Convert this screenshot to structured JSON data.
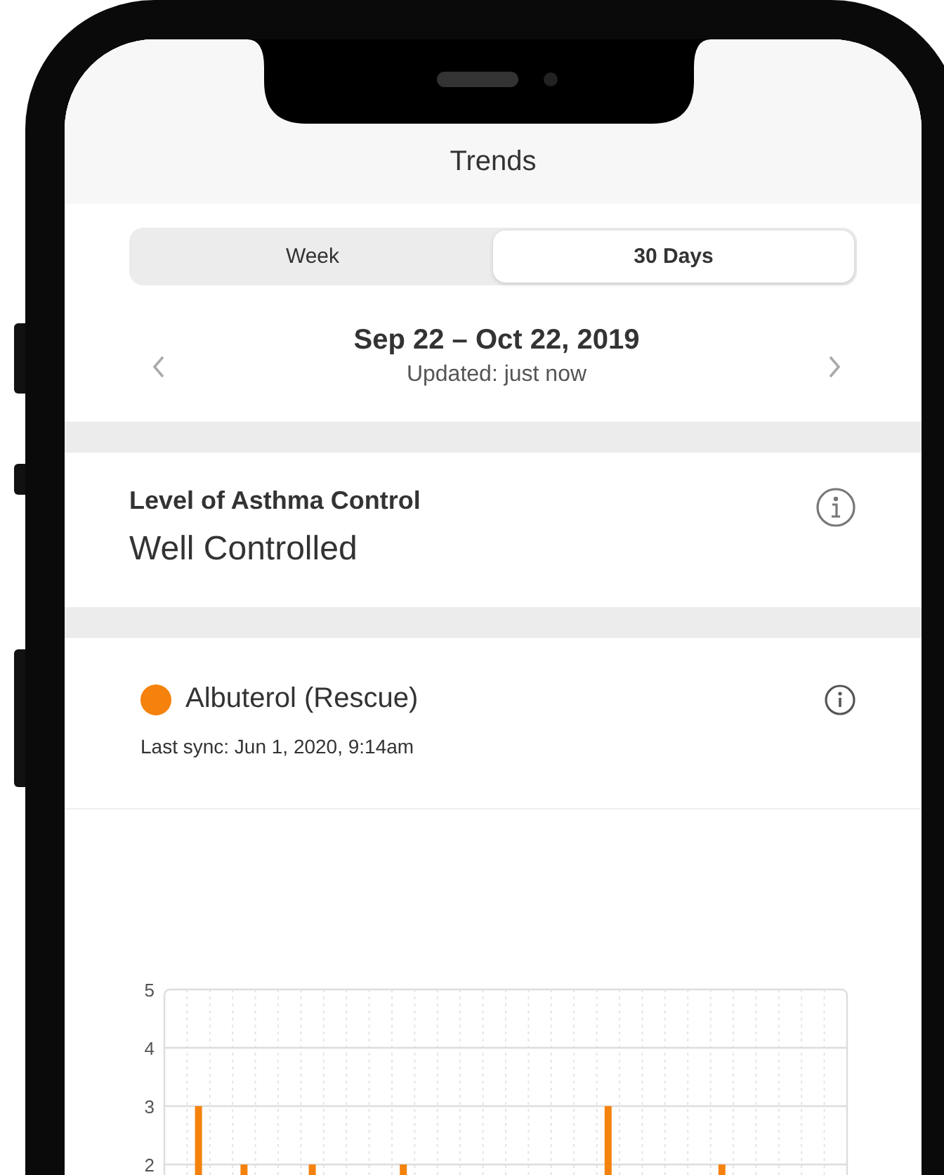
{
  "header": {
    "title": "Trends"
  },
  "tabs": [
    {
      "label": "Week",
      "selected": false
    },
    {
      "label": "30 Days",
      "selected": true
    }
  ],
  "date_range": {
    "range": "Sep 22 – Oct 22, 2019",
    "updated": "Updated: just now"
  },
  "control_card": {
    "label": "Level of Asthma Control",
    "value": "Well Controlled"
  },
  "medication_card": {
    "name": "Albuterol (Rescue)",
    "color": "#f5820d",
    "last_sync": "Last sync: Jun 1, 2020, 9:14am",
    "chart_data": {
      "type": "bar",
      "ylim": [
        0,
        5
      ],
      "yticks": [
        2,
        3,
        4,
        5
      ],
      "grid": true,
      "values": [
        null,
        3,
        null,
        2,
        null,
        null,
        2,
        null,
        null,
        null,
        2,
        null,
        null,
        null,
        null,
        null,
        null,
        null,
        null,
        3,
        null,
        null,
        null,
        null,
        2,
        null,
        null,
        null,
        null,
        null
      ]
    }
  }
}
